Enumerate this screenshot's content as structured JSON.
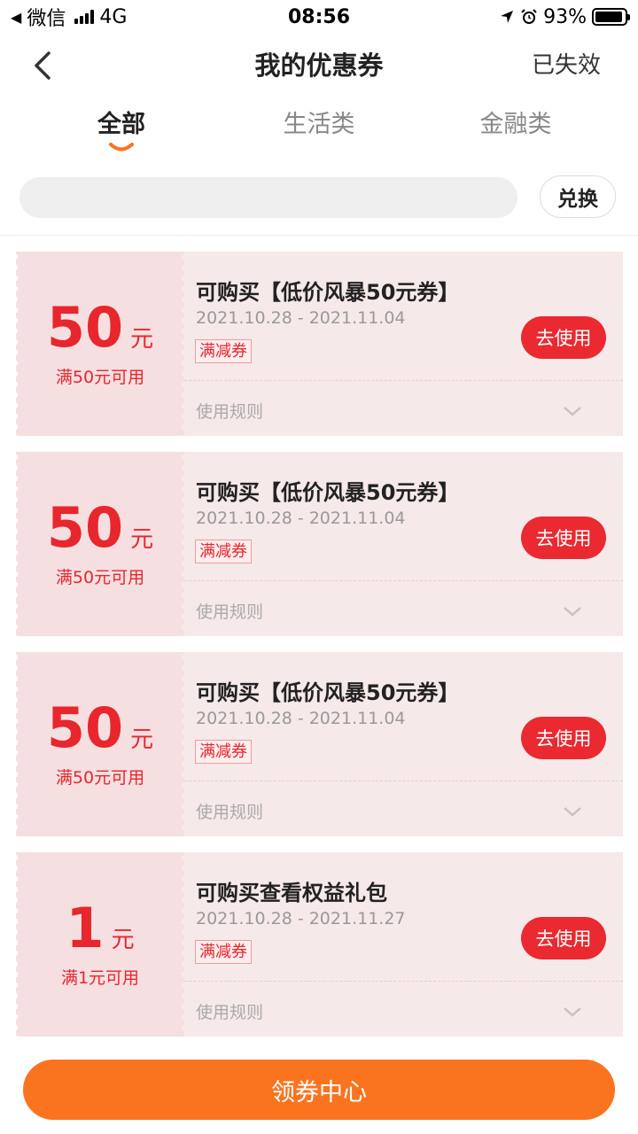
{
  "status_bar": {
    "carrier": "微信",
    "network": "4G",
    "time": "08:56",
    "battery": "93%",
    "battery_level": 0.93
  },
  "header": {
    "title": "我的优惠券",
    "expired_label": "已失效"
  },
  "tabs": [
    {
      "label": "全部",
      "active": true
    },
    {
      "label": "生活类",
      "active": false
    },
    {
      "label": "金融类",
      "active": false
    }
  ],
  "search": {
    "placeholder": "",
    "value": "",
    "redeem_label": "兑换"
  },
  "coupons": [
    {
      "amount": "50",
      "unit": "元",
      "threshold": "满50元可用",
      "name": "可购买【低价风暴50元券】",
      "dates": "2021.10.28 - 2021.11.04",
      "tag": "满减券",
      "use_label": "去使用",
      "rules_label": "使用规则"
    },
    {
      "amount": "50",
      "unit": "元",
      "threshold": "满50元可用",
      "name": "可购买【低价风暴50元券】",
      "dates": "2021.10.28 - 2021.11.04",
      "tag": "满减券",
      "use_label": "去使用",
      "rules_label": "使用规则"
    },
    {
      "amount": "50",
      "unit": "元",
      "threshold": "满50元可用",
      "name": "可购买【低价风暴50元券】",
      "dates": "2021.10.28 - 2021.11.04",
      "tag": "满减券",
      "use_label": "去使用",
      "rules_label": "使用规则"
    },
    {
      "amount": "1",
      "unit": "元",
      "threshold": "满1元可用",
      "name": "可购买查看权益礼包",
      "dates": "2021.10.28 - 2021.11.27",
      "tag": "满减券",
      "use_label": "去使用",
      "rules_label": "使用规则"
    }
  ],
  "footer": {
    "coupon_center_label": "领券中心"
  },
  "colors": {
    "accent_red": "#ea2930",
    "accent_orange": "#fa7420",
    "coupon_bg": "#f6e9ea"
  },
  "icons": [
    "back-arrow-icon",
    "location-arrow-icon",
    "alarm-icon",
    "battery-icon",
    "signal-icon",
    "chevron-down-icon"
  ]
}
